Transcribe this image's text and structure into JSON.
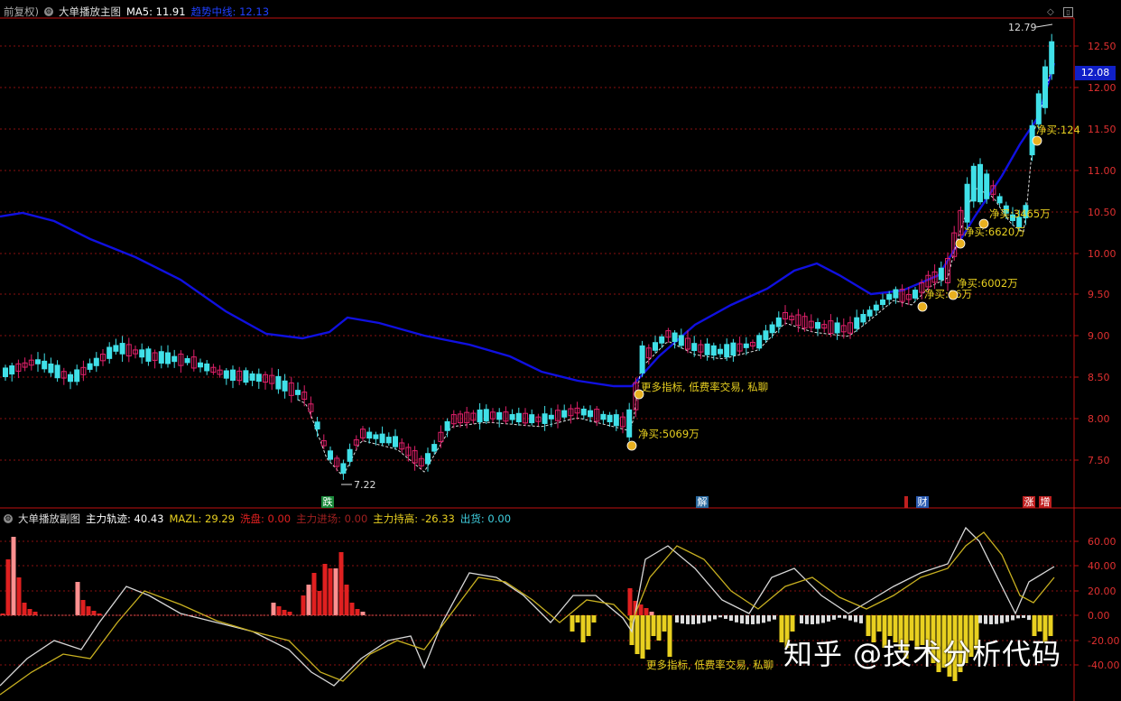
{
  "top_panel": {
    "header": {
      "mode": "前复权)",
      "indicator_name": "大单播放主图",
      "ma5_label": "MA5: 11.91",
      "ma_extra": "趋势中线: 12.13"
    },
    "price_tag": "12.08",
    "y_ticks": [
      "12.50",
      "12.00",
      "11.50",
      "11.00",
      "10.50",
      "10.00",
      "9.50",
      "9.00",
      "8.50",
      "8.00",
      "7.50"
    ],
    "high_label": "12.79",
    "low_label": "7.22",
    "annotations": [
      {
        "text": "净买:5069万",
        "color": "#e8d020"
      },
      {
        "text": "更多指标, 低费率交易, 私聊",
        "color": "#e8d020"
      },
      {
        "text": "净买:6002万",
        "color": "#e8d020"
      },
      {
        "text": "净买:06万",
        "color": "#e8d020"
      },
      {
        "text": "净买:6620万",
        "color": "#e8d020"
      },
      {
        "text": "净买:3465万",
        "color": "#e8d020"
      },
      {
        "text": "净买:124",
        "color": "#e8d020"
      }
    ],
    "markers": [
      {
        "text": "跌",
        "bg": "#1a8a3a"
      },
      {
        "text": "解",
        "bg": "#2a6aa0"
      },
      {
        "text": "财",
        "bg": "#2a5ab0"
      },
      {
        "text": "涨",
        "bg": "#c02020"
      },
      {
        "text": "增",
        "bg": "#c02020"
      }
    ]
  },
  "bottom_panel": {
    "header": {
      "name": "大单播放副图",
      "main_track": "主力轨迹: 40.43",
      "mazl": "MAZL: 29.29",
      "xipan": "洗盘: 0.00",
      "zhuli_jinchang": "主力进场: 0.00",
      "zhuli_cungao": "主力持高: -26.33",
      "chuhuo": "出货: 0.00"
    },
    "y_ticks": [
      "60.00",
      "40.00",
      "20.00",
      "0.00",
      "-20.00",
      "-40.00"
    ],
    "annotation": "更多指标, 低费率交易, 私聊"
  },
  "watermark": "知乎 @技术分析代码",
  "colors": {
    "up_candle": "#e0206a",
    "down_candle": "#40e0e8",
    "ma_line": "#1010e0",
    "grid": "#8a1010",
    "axis": "#c01010",
    "yellow": "#e8d020",
    "red_bar": "#e02020"
  }
}
